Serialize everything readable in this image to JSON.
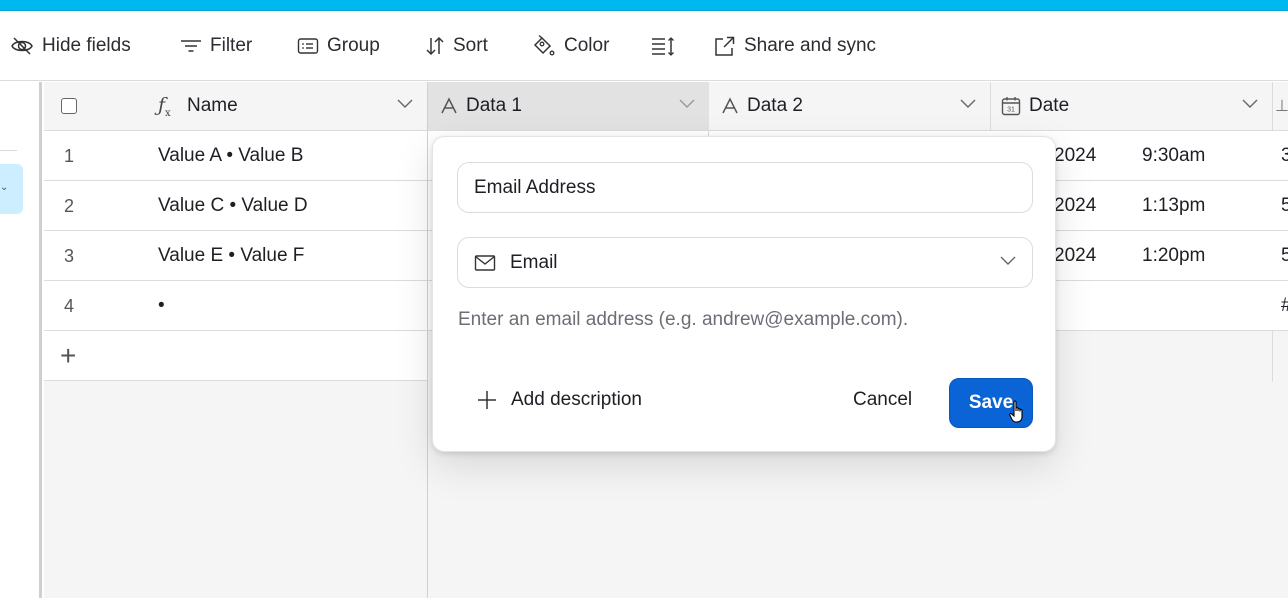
{
  "colors": {
    "topbar": "#00b8f0",
    "accent": "#0a64d6",
    "selected_nav": "#cdeeff"
  },
  "toolbar": {
    "items": [
      {
        "label": "Hide fields",
        "icon": "eye-off-icon"
      },
      {
        "label": "Filter",
        "icon": "filter-icon"
      },
      {
        "label": "Group",
        "icon": "group-icon"
      },
      {
        "label": "Sort",
        "icon": "sort-icon"
      },
      {
        "label": "Color",
        "icon": "paint-bucket-icon"
      },
      {
        "label": "",
        "icon": "row-height-icon"
      },
      {
        "label": "Share and sync",
        "icon": "share-icon"
      }
    ]
  },
  "grid": {
    "columns": [
      {
        "label": "Name",
        "icon": "formula-icon"
      },
      {
        "label": "Data 1",
        "icon": "text-icon"
      },
      {
        "label": "Data 2",
        "icon": "text-icon"
      },
      {
        "label": "Date",
        "icon": "calendar-icon"
      }
    ],
    "rows": [
      {
        "num": "1",
        "name": "Value A • Value B",
        "date": "2024",
        "time": "9:30am",
        "extra": "3"
      },
      {
        "num": "2",
        "name": "Value C • Value D",
        "date": "2024",
        "time": "1:13pm",
        "extra": "5"
      },
      {
        "num": "3",
        "name": "Value E • Value F",
        "date": "2024",
        "time": "1:20pm",
        "extra": "5"
      },
      {
        "num": "4",
        "name": "•",
        "date": "",
        "time": "",
        "extra": "#"
      }
    ],
    "add_row_label": "+"
  },
  "field_editor": {
    "field_name": "Email Address",
    "field_type": "Email",
    "help_text": "Enter an email address (e.g. andrew@example.com).",
    "add_description_label": "Add description",
    "cancel_label": "Cancel",
    "save_label": "Save"
  }
}
